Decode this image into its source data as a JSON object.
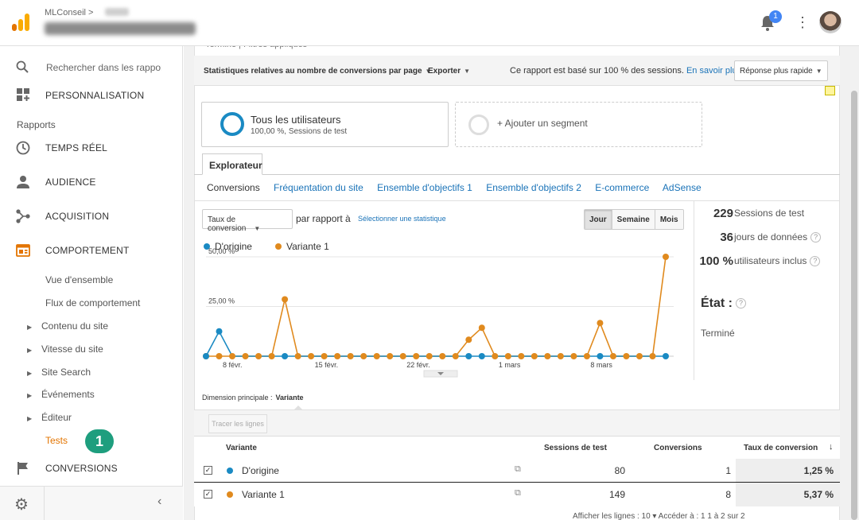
{
  "header": {
    "account": "MLConseil",
    "notification_count": "1"
  },
  "sidebar": {
    "search_placeholder": "Rechercher dans les rapports",
    "personnalisation": "PERSONNALISATION",
    "section_label": "Rapports",
    "items": [
      {
        "label": "TEMPS RÉEL"
      },
      {
        "label": "AUDIENCE"
      },
      {
        "label": "ACQUISITION"
      },
      {
        "label": "COMPORTEMENT"
      }
    ],
    "behavior_sub": [
      {
        "label": "Vue d'ensemble"
      },
      {
        "label": "Flux de comportement"
      }
    ],
    "behavior_expand": [
      {
        "label": "Contenu du site"
      },
      {
        "label": "Vitesse du site"
      },
      {
        "label": "Site Search"
      },
      {
        "label": "Événements"
      },
      {
        "label": "Éditeur"
      }
    ],
    "active_sub": "Tests",
    "step_badge": "1",
    "conversions": "CONVERSIONS"
  },
  "top_clipped": {
    "text": "Terminé   |   Filtres appliqués"
  },
  "toolbar": {
    "report_title": "Statistiques relatives au nombre de conversions par page",
    "export": "Exporter",
    "info_text": "Ce rapport est basé sur 100 % des sessions.",
    "info_link": "En savoir plus",
    "response_button": "Réponse plus rapide"
  },
  "segments": {
    "all_users": "Tous les utilisateurs",
    "all_users_sub": "100,00 %, Sessions de test",
    "add_segment": "+ Ajouter un segment"
  },
  "tabs": {
    "explorer": "Explorateur",
    "subtabs": [
      "Conversions",
      "Fréquentation du site",
      "Ensemble d'objectifs 1",
      "Ensemble d'objectifs 2",
      "E-commerce",
      "AdSense"
    ]
  },
  "chart_controls": {
    "metric": "Taux de conversion",
    "compare": "par rapport à",
    "select_stat": "Sélectionner une statistique",
    "periods": [
      "Jour",
      "Semaine",
      "Mois"
    ],
    "active_period": "Jour"
  },
  "chart_data": {
    "type": "line",
    "title": "",
    "xlabel": "",
    "ylabel": "",
    "ylim": [
      0,
      60
    ],
    "yticks": [
      {
        "value": 25,
        "label": "25,00 %"
      },
      {
        "value": 50,
        "label": "50,00 %"
      }
    ],
    "xticks": [
      {
        "index": 2,
        "label": "8 févr."
      },
      {
        "index": 9,
        "label": "15 févr."
      },
      {
        "index": 16,
        "label": "22 févr."
      },
      {
        "index": 23,
        "label": "1 mars"
      },
      {
        "index": 30,
        "label": "8 mars"
      }
    ],
    "legend_position": "top-left",
    "series": [
      {
        "name": "D'origine",
        "color": "#1a8ac3",
        "values": [
          0,
          12.5,
          0,
          0,
          0,
          0,
          0,
          0,
          0,
          0,
          0,
          0,
          0,
          0,
          0,
          0,
          0,
          0,
          0,
          0,
          0,
          0,
          0,
          0,
          0,
          0,
          0,
          0,
          0,
          0,
          0,
          0,
          0,
          0,
          0,
          0
        ]
      },
      {
        "name": "Variante 1",
        "color": "#e08a1e",
        "values": [
          0,
          0,
          0,
          0,
          0,
          0,
          28.6,
          0,
          0,
          0,
          0,
          0,
          0,
          0,
          0,
          0,
          0,
          0,
          0,
          0,
          8.3,
          14.3,
          0,
          0,
          0,
          0,
          0,
          0,
          0,
          0,
          16.7,
          0,
          0,
          0,
          0,
          50
        ]
      }
    ]
  },
  "stats": {
    "sessions_value": "229",
    "sessions_label": "Sessions de test",
    "days_value": "36",
    "days_label": "jours de données",
    "users_value": "100 %",
    "users_label": "utilisateurs inclus",
    "state_label": "État :",
    "state_value": "Terminé"
  },
  "table": {
    "dimension_label": "Dimension principale :",
    "dimension_value": "Variante",
    "tracer_button": "Tracer les lignes",
    "columns": [
      "Variante",
      "Sessions de test",
      "Conversions",
      "Taux de conversion"
    ],
    "rows": [
      {
        "name": "D'origine",
        "color": "#1a8ac3",
        "sessions": "80",
        "conversions": "1",
        "rate": "1,25 %"
      },
      {
        "name": "Variante 1",
        "color": "#e08a1e",
        "sessions": "149",
        "conversions": "8",
        "rate": "5,37 %"
      }
    ],
    "pager_text": "Afficher les lignes :  10  ▾   Accéder à :  1   1 à 2 sur 2"
  }
}
